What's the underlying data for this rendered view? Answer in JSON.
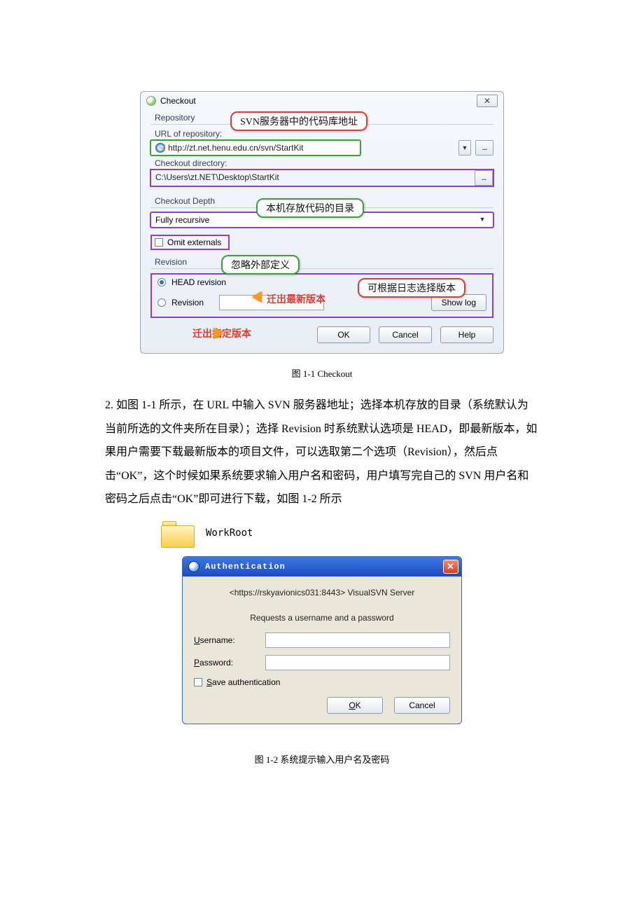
{
  "fig1": {
    "dialog_title": "Checkout",
    "close_glyph": "✕",
    "repo_group_label": "Repository",
    "url_label": "URL of repository:",
    "url_value": "http://zt.net.henu.edu.cn/svn/StartKit",
    "dir_label": "Checkout directory:",
    "dir_value": "C:\\Users\\zt.NET\\Desktop\\StartKit",
    "depth_group_label": "Checkout Depth",
    "depth_value": "Fully recursive",
    "omit_label": "Omit externals",
    "revision_group_label": "Revision",
    "head_label": "HEAD revision",
    "revision_label": "Revision",
    "showlog_btn": "Show log",
    "browse_glyph": "...",
    "dropdown_glyph": "▼",
    "ok": "OK",
    "cancel": "Cancel",
    "help": "Help",
    "annotations": {
      "url_callout": "SVN服务器中的代码库地址",
      "dir_callout": "本机存放代码的目录",
      "omit_callout": "忽略外部定义",
      "head_callout": "迁出最新版本",
      "showlog_callout": "可根据日志选择版本",
      "revnum_callout": "迁出指定版本"
    },
    "caption": "图 1-1 Checkout"
  },
  "body_text": "2. 如图 1-1 所示，在 URL 中输入 SVN 服务器地址；选择本机存放的目录（系统默认为当前所选的文件夹所在目录）；选择 Revision 时系统默认选项是 HEAD，即最新版本，如果用户需要下载最新版本的项目文件，可以选取第二个选项（Revision），然后点击“OK”，这个时候如果系统要求输入用户名和密码，用户填写完自己的 SVN 用户名和密码之后点击“OK”即可进行下载，如图 1-2 所示",
  "folder_name": "WorkRoot",
  "fig2": {
    "dialog_title": "Authentication",
    "close_glyph": "✕",
    "server_line": "<https://rskyavionics031:8443> VisualSVN Server",
    "prompt_line": "Requests a username and a password",
    "username_prefix": "U",
    "username_rest": "sername:",
    "password_prefix": "P",
    "password_rest": "assword:",
    "save_prefix": "S",
    "save_rest": "ave authentication",
    "ok_prefix": "O",
    "ok_rest": "K",
    "cancel": "Cancel",
    "caption": "图 1-2  系统提示输入用户名及密码"
  }
}
